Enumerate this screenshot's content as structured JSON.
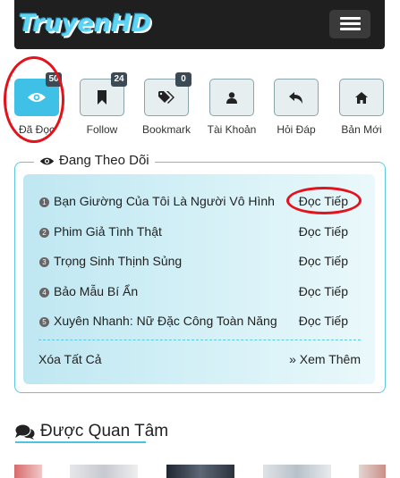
{
  "header": {
    "logo_text": "TruyenHD",
    "menu_icon": "hamburger-icon"
  },
  "nav": [
    {
      "label": "Đã Đọc",
      "icon": "eye-icon",
      "badge": "50",
      "active": true
    },
    {
      "label": "Follow",
      "icon": "bookmark-icon",
      "badge": "24",
      "active": false
    },
    {
      "label": "Bookmark",
      "icon": "tags-icon",
      "badge": "0",
      "active": false
    },
    {
      "label": "Tài Khoản",
      "icon": "user-icon",
      "badge": "",
      "active": false
    },
    {
      "label": "Hỏi Đáp",
      "icon": "reply-icon",
      "badge": "",
      "active": false
    },
    {
      "label": "Bản Mới",
      "icon": "home-icon",
      "badge": "",
      "active": false
    }
  ],
  "following": {
    "title": "Đang Theo Dõi",
    "items": [
      {
        "num": "1",
        "title": "Bạn Giường Của Tôi Là Người Vô Hình",
        "action": "Đọc Tiếp"
      },
      {
        "num": "2",
        "title": "Phim Giả Tình Thật",
        "action": "Đọc Tiếp"
      },
      {
        "num": "3",
        "title": "Trọng Sinh Thịnh Sủng",
        "action": "Đọc Tiếp"
      },
      {
        "num": "4",
        "title": "Bảo Mẫu Bí Ẩn",
        "action": "Đọc Tiếp"
      },
      {
        "num": "5",
        "title": "Xuyên Nhanh: Nữ Đặc Công Toàn Năng",
        "action": "Đọc Tiếp"
      }
    ],
    "clear_all": "Xóa Tất Cả",
    "see_more": "» Xem Thêm"
  },
  "section": {
    "title": "Được Quan Tâm"
  },
  "colors": {
    "accent": "#3fc0e6",
    "annotation": "#e3121b",
    "header_bg": "#1f1f1f"
  }
}
